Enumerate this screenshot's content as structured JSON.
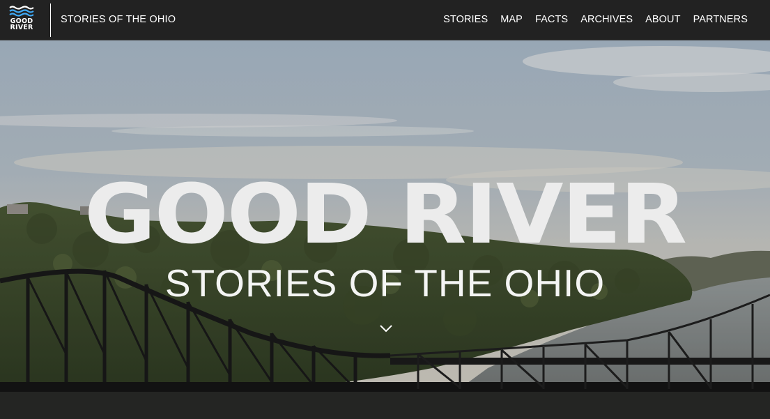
{
  "nav": {
    "logo_text": [
      "GOOD",
      "RIVER"
    ],
    "title": "STORIES OF THE OHIO",
    "links": [
      "STORIES",
      "MAP",
      "FACTS",
      "ARCHIVES",
      "ABOUT",
      "PARTNERS"
    ]
  },
  "hero": {
    "title": "GOOD RIVER",
    "subtitle": "STORIES OF THE OHIO",
    "scroll_icon": "chevron-down-icon"
  },
  "colors": {
    "nav_bg": "#222222",
    "logo_wave": "#3fa9f5",
    "title_text": "#ececec"
  }
}
